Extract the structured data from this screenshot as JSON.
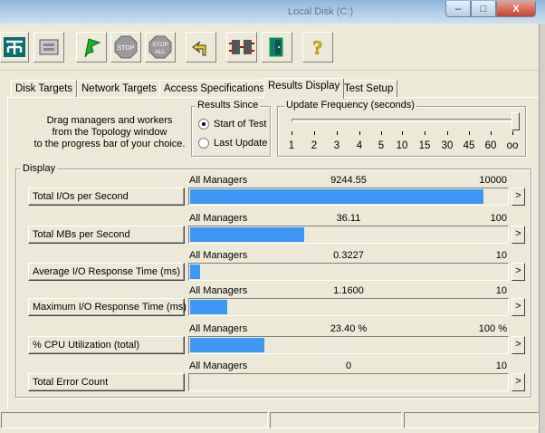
{
  "background_window": {
    "title": "Local Disk (C:)"
  },
  "window_controls": {
    "minimize": "–",
    "maximize": "□",
    "close": "X"
  },
  "toolbar": {
    "buttons": [
      {
        "icon": "topology-icon"
      },
      {
        "icon": "workers-icon"
      },
      {
        "icon": "start-flag-icon"
      },
      {
        "icon": "stop-icon",
        "label": "STOP"
      },
      {
        "icon": "stop-all-icon",
        "label": "STOP ALL"
      },
      {
        "icon": "reset-arrow-icon"
      },
      {
        "icon": "disconnect-icon"
      },
      {
        "icon": "exit-door-icon"
      },
      {
        "icon": "help-icon",
        "label": "?"
      }
    ]
  },
  "tabs": [
    {
      "label": "Disk Targets"
    },
    {
      "label": "Network Targets"
    },
    {
      "label": "Access Specifications"
    },
    {
      "label": "Results Display",
      "active": true
    },
    {
      "label": "Test Setup"
    }
  ],
  "drag_instructions": {
    "line1": "Drag managers and workers",
    "line2": "from the Topology window",
    "line3": "to the progress bar of your choice."
  },
  "results_since": {
    "legend": "Results Since",
    "options": [
      {
        "label": "Start of Test",
        "selected": true
      },
      {
        "label": "Last Update",
        "selected": false
      }
    ]
  },
  "update_frequency": {
    "legend": "Update Frequency (seconds)",
    "ticks": [
      "1",
      "2",
      "3",
      "4",
      "5",
      "10",
      "15",
      "30",
      "45",
      "60",
      "oo"
    ],
    "selected": "oo"
  },
  "display": {
    "legend": "Display",
    "rows": [
      {
        "button": "Total I/Os per Second",
        "source": "All Managers",
        "value": "9244.55",
        "max": "10000",
        "fill_fraction": 0.92445
      },
      {
        "button": "Total MBs per Second",
        "source": "All Managers",
        "value": "36.11",
        "max": "100",
        "fill_fraction": 0.3611
      },
      {
        "button": "Average I/O Response Time (ms)",
        "source": "All Managers",
        "value": "0.3227",
        "max": "10",
        "fill_fraction": 0.03227
      },
      {
        "button": "Maximum I/O Response Time (ms)",
        "source": "All Managers",
        "value": "1.1600",
        "max": "10",
        "fill_fraction": 0.116
      },
      {
        "button": "% CPU Utilization (total)",
        "source": "All Managers",
        "value": "23.40 %",
        "max": "100 %",
        "fill_fraction": 0.234
      },
      {
        "button": "Total Error Count",
        "source": "All Managers",
        "value": "0",
        "max": "10",
        "fill_fraction": 0
      }
    ],
    "arrow_label": ">"
  },
  "colors": {
    "bar_fill": "#3c98f2",
    "face": "#ece9d8"
  }
}
